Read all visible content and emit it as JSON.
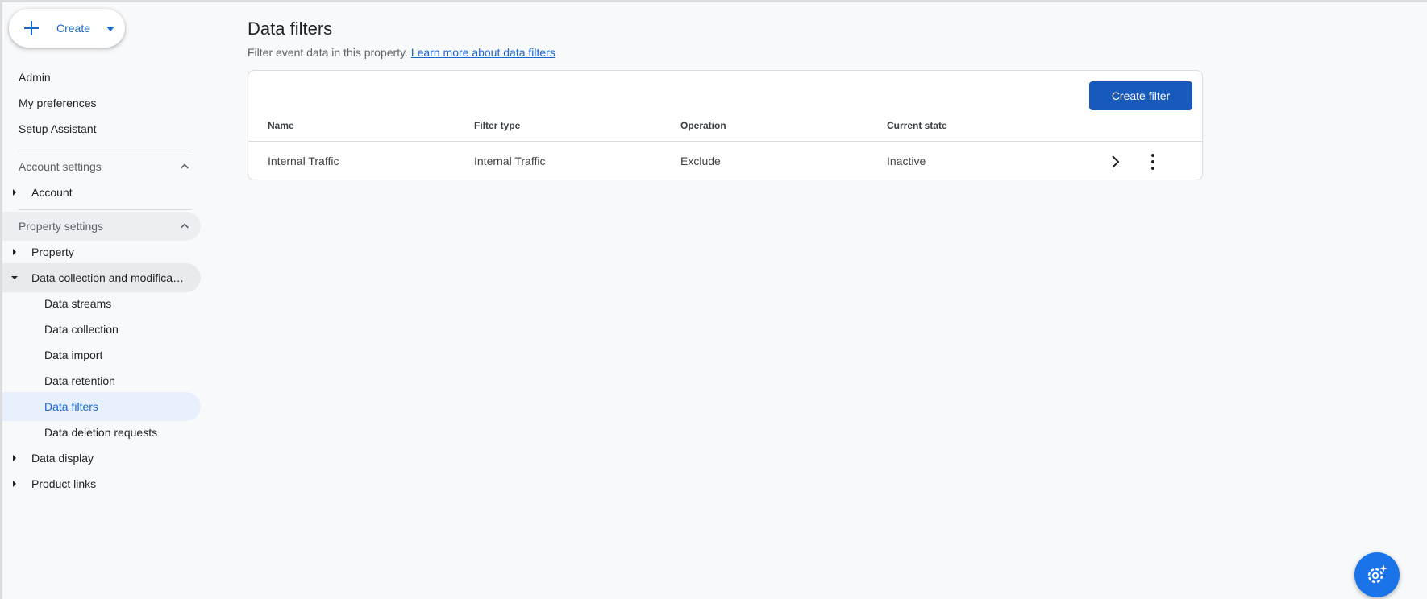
{
  "sidebar": {
    "create_label": "Create",
    "top_items": [
      "Admin",
      "My preferences",
      "Setup Assistant"
    ],
    "account_settings_label": "Account settings",
    "account_label": "Account",
    "property_settings_label": "Property settings",
    "property_label": "Property",
    "data_collection_label": "Data collection and modifica…",
    "data_collection_sub": [
      "Data streams",
      "Data collection",
      "Data import",
      "Data retention",
      "Data filters",
      "Data deletion requests"
    ],
    "data_display_label": "Data display",
    "product_links_label": "Product links",
    "active_item": "Data filters"
  },
  "main": {
    "title": "Data filters",
    "subtitle": "Filter event data in this property.",
    "learn_more": "Learn more about data filters",
    "create_filter_label": "Create filter",
    "table": {
      "headers": [
        "Name",
        "Filter type",
        "Operation",
        "Current state"
      ],
      "rows": [
        [
          "Internal Traffic",
          "Internal Traffic",
          "Exclude",
          "Inactive"
        ]
      ]
    }
  },
  "colors": {
    "accent": "#1967d2",
    "primary_button": "#185abc",
    "active_bg": "#e8f0fe",
    "fab": "#1a73e8"
  },
  "icons": {
    "fab": "settings-sparkle-icon"
  }
}
